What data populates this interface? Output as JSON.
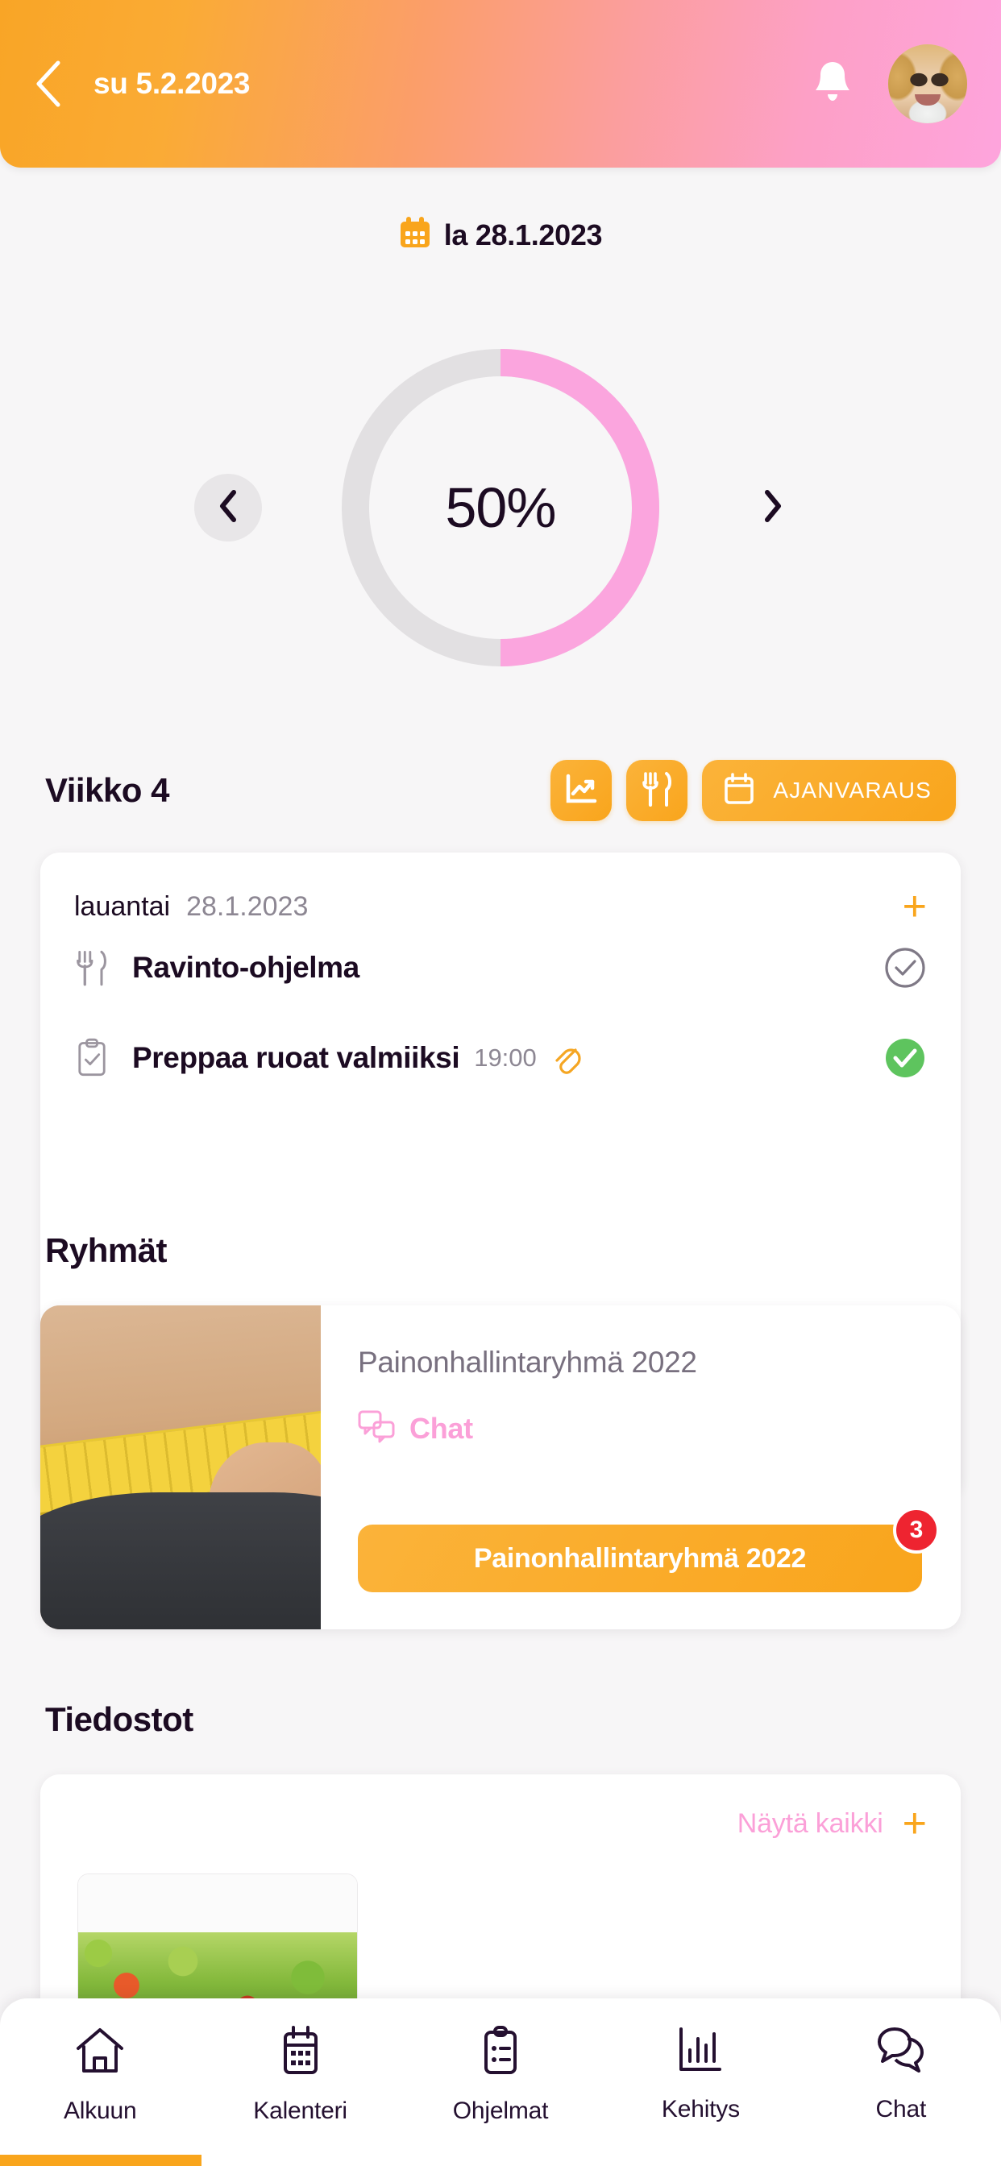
{
  "header": {
    "back_icon": "chevron-left-icon",
    "date": "su 5.2.2023",
    "bell_icon": "bell-icon",
    "avatar_icon": "user-avatar"
  },
  "date_row": {
    "calendar_icon": "calendar-icon",
    "date": "la 28.1.2023"
  },
  "progress": {
    "percent_label": "50%",
    "percent_value": 50,
    "prev_icon": "chevron-left-icon",
    "next_icon": "chevron-right-icon",
    "track_color": "#e2e0e2",
    "fill_color": "#fba5de"
  },
  "week": {
    "title": "Viikko 4",
    "actions": [
      {
        "icon": "chart-line-icon",
        "label": ""
      },
      {
        "icon": "fork-knife-icon",
        "label": ""
      },
      {
        "icon": "calendar-icon",
        "label": "AJANVARAUS"
      }
    ]
  },
  "tasks": {
    "day_name": "lauantai",
    "day_date": "28.1.2023",
    "add_icon": "plus-icon",
    "items": [
      {
        "icon": "fork-knife-icon",
        "name": "Ravinto-ohjelma",
        "time": "",
        "attachment_icon": "",
        "status_icon": "check-circle-outline-icon",
        "done": false
      },
      {
        "icon": "clipboard-check-icon",
        "name": "Preppaa ruoat valmiiksi",
        "time": "19:00",
        "attachment_icon": "paperclip-icon",
        "status_icon": "check-circle-filled-icon",
        "done": true
      }
    ]
  },
  "groups": {
    "section_title": "Ryhmät",
    "card": {
      "image_alt": "measuring-tape-waist-photo",
      "name": "Painonhallintaryhmä 2022",
      "chat_icon": "chat-bubbles-icon",
      "chat_label": "Chat",
      "button_label": "Painonhallintaryhmä 2022",
      "badge_count": "3"
    }
  },
  "files": {
    "section_title": "Tiedostot",
    "show_all_label": "Näytä kaikki",
    "add_icon": "plus-icon",
    "thumbnails": [
      {
        "alt": "salad-photo"
      }
    ]
  },
  "bottom_nav": {
    "items": [
      {
        "icon": "home-icon",
        "label": "Alkuun"
      },
      {
        "icon": "calendar-icon",
        "label": "Kalenteri"
      },
      {
        "icon": "clipboard-icon",
        "label": "Ohjelmat"
      },
      {
        "icon": "bar-chart-icon",
        "label": "Kehitys"
      },
      {
        "icon": "chat-bubbles-icon",
        "label": "Chat"
      }
    ]
  },
  "colors": {
    "orange": "#f9a51c",
    "pink": "#fba0d8",
    "dark": "#1c0b22",
    "green": "#5ec45e",
    "red": "#ee2430"
  }
}
